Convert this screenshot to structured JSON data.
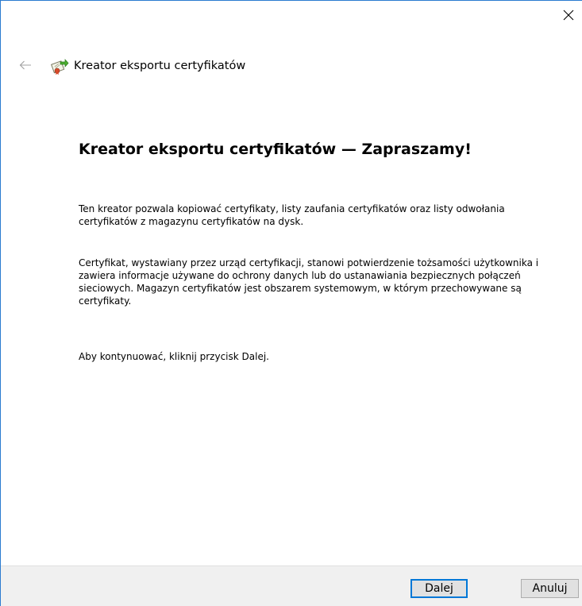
{
  "window": {
    "close_icon": "close-icon",
    "back_icon": "back-arrow-icon"
  },
  "header": {
    "icon": "certificate-wizard-icon",
    "title": "Kreator eksportu certyfikatów"
  },
  "content": {
    "heading": "Kreator eksportu certyfikatów — Zapraszamy!",
    "paragraph1": "Ten kreator pozwala kopiować certyfikaty, listy zaufania certyfikatów oraz listy odwołania certyfikatów z magazynu certyfikatów na dysk.",
    "paragraph2": "Certyfikat, wystawiany przez urząd certyfikacji, stanowi potwierdzenie tożsamości użytkownika i zawiera informacje używane do ochrony danych lub do ustanawiania bezpiecznych połączeń sieciowych. Magazyn certyfikatów jest obszarem systemowym, w którym przechowywane są certyfikaty.",
    "paragraph3": "Aby kontynuować, kliknij przycisk Dalej."
  },
  "footer": {
    "next_label": "Dalej",
    "cancel_label": "Anuluj"
  },
  "colors": {
    "window_border": "#2b7bd0",
    "default_button_border": "#0078d7",
    "footer_background": "#f0f0f0"
  }
}
